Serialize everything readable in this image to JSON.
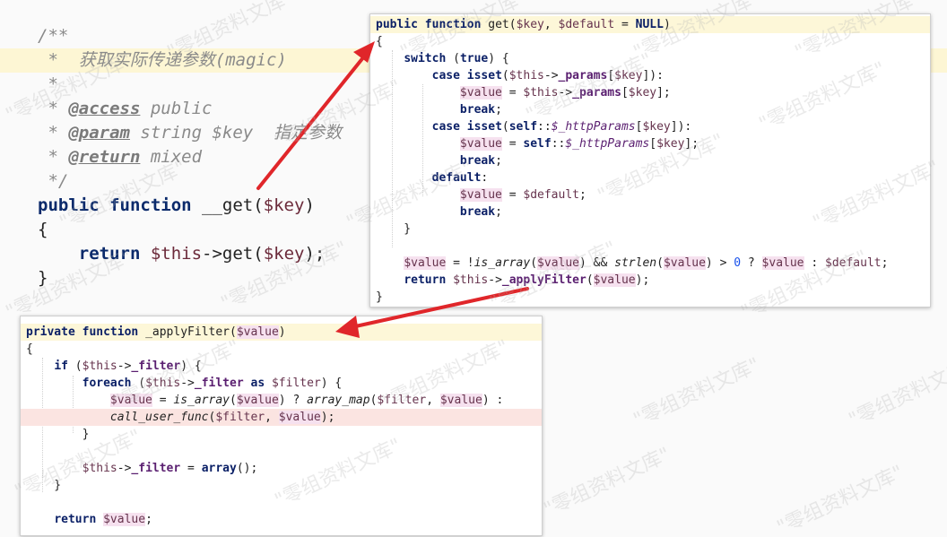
{
  "background_code": [
    {
      "t": "comment",
      "text": "/**"
    },
    {
      "t": "comment",
      "text": " *  获取实际传递参数(magic)",
      "highlight": true
    },
    {
      "t": "comment",
      "text": " *"
    },
    {
      "t": "doc",
      "tag": "@access",
      "rest": " public"
    },
    {
      "t": "doc",
      "tag": "@param",
      "rest": " string $key  指定参数"
    },
    {
      "t": "doc",
      "tag": "@return",
      "rest": " mixed"
    },
    {
      "t": "comment",
      "text": " */"
    },
    {
      "t": "code",
      "text": "public function __get($key)"
    },
    {
      "t": "code",
      "text": "{"
    },
    {
      "t": "code",
      "text": "    return $this->get($key);"
    },
    {
      "t": "code",
      "text": "}"
    }
  ],
  "panel_get": {
    "lines": [
      "public function get($key, $default = NULL)",
      "{",
      "    switch (true) {",
      "        case isset($this->_params[$key]):",
      "            $value = $this->_params[$key];",
      "            break;",
      "        case isset(self::$_httpParams[$key]):",
      "            $value = self::$_httpParams[$key];",
      "            break;",
      "        default:",
      "            $value = $default;",
      "            break;",
      "    }",
      "",
      "    $value = !is_array($value) && strlen($value) > 0 ? $value : $default;",
      "    return $this->_applyFilter($value);",
      "}"
    ]
  },
  "panel_filter": {
    "lines": [
      "private function _applyFilter($value)",
      "{",
      "    if ($this->_filter) {",
      "        foreach ($this->_filter as $filter) {",
      "            $value = is_array($value) ? array_map($filter, $value) :",
      "            call_user_func($filter, $value);",
      "        }",
      "",
      "        $this->_filter = array();",
      "    }",
      "",
      "    return $value;"
    ]
  },
  "watermark_text": "零组资料文库",
  "colors": {
    "arrow": "#e0262a",
    "keyword": "#0a1f66",
    "variable": "#66334d"
  }
}
